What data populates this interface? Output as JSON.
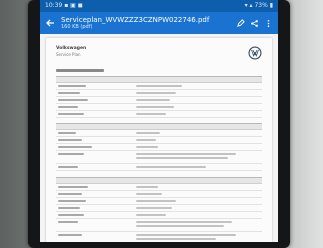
{
  "statusbar": {
    "left": "10:39 ▪ ▣ ◼",
    "right": "▾ ▴ 73% ▮"
  },
  "appbar": {
    "title": "Serviceplan_WVWZZZ3CZNPW022746.pdf",
    "subtitle": "160 KB (pdf)"
  },
  "document": {
    "sender_line1": "Volkswagen",
    "sender_line2": "Service Plan"
  }
}
